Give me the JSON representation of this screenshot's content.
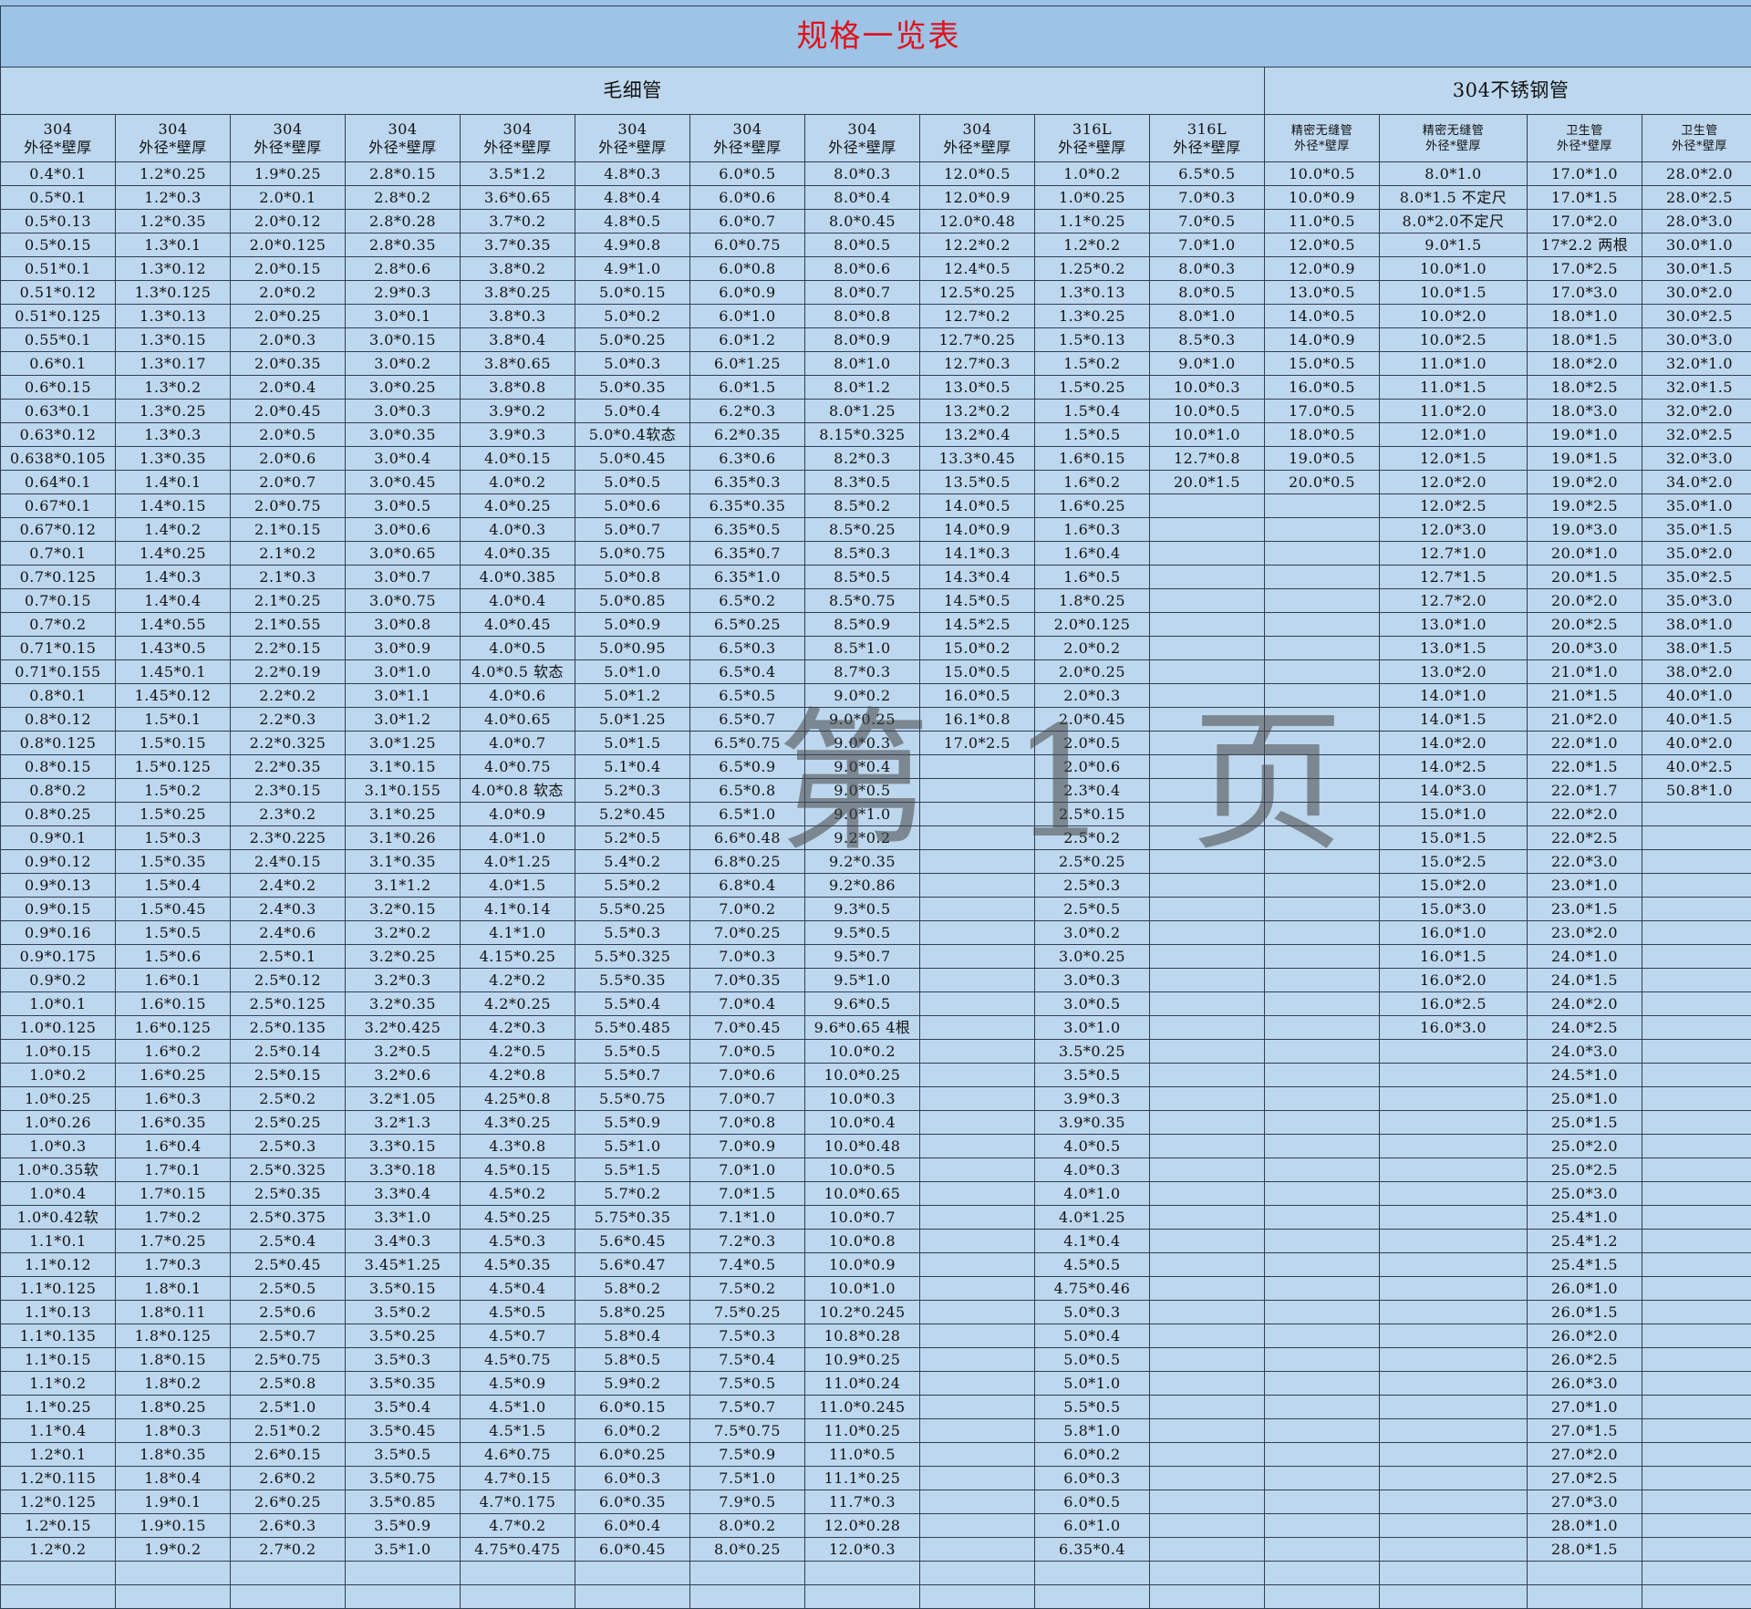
{
  "title": "规格一览表",
  "groups": [
    {
      "label": "毛细管",
      "span": 11
    },
    {
      "label": "304不锈钢管",
      "span": 4
    }
  ],
  "columns": [
    {
      "line1": "304",
      "line2": "外径*壁厚"
    },
    {
      "line1": "304",
      "line2": "外径*壁厚"
    },
    {
      "line1": "304",
      "line2": "外径*壁厚"
    },
    {
      "line1": "304",
      "line2": "外径*壁厚"
    },
    {
      "line1": "304",
      "line2": "外径*壁厚"
    },
    {
      "line1": "304",
      "line2": "外径*壁厚"
    },
    {
      "line1": "304",
      "line2": "外径*壁厚"
    },
    {
      "line1": "304",
      "line2": "外径*壁厚"
    },
    {
      "line1": "304",
      "line2": "外径*壁厚"
    },
    {
      "line1": "316L",
      "line2": "外径*壁厚"
    },
    {
      "line1": "316L",
      "line2": "外径*壁厚"
    },
    {
      "line1": "精密无缝管",
      "line2": "外径*壁厚"
    },
    {
      "line1": "精密无缝管",
      "line2": "外径*壁厚"
    },
    {
      "line1": "卫生管",
      "line2": "外径*壁厚"
    },
    {
      "line1": "卫生管",
      "line2": "外径*壁厚"
    }
  ],
  "column_data": [
    [
      "0.4*0.1",
      "0.5*0.1",
      "0.5*0.13",
      "0.5*0.15",
      "0.51*0.1",
      "0.51*0.12",
      "0.51*0.125",
      "0.55*0.1",
      "0.6*0.1",
      "0.6*0.15",
      "0.63*0.1",
      "0.63*0.12",
      "0.638*0.105",
      "0.64*0.1",
      "0.67*0.1",
      "0.67*0.12",
      "0.7*0.1",
      "0.7*0.125",
      "0.7*0.15",
      "0.7*0.2",
      "0.71*0.15",
      "0.71*0.155",
      "0.8*0.1",
      "0.8*0.12",
      "0.8*0.125",
      "0.8*0.15",
      "0.8*0.2",
      "0.8*0.25",
      "0.9*0.1",
      "0.9*0.12",
      "0.9*0.13",
      "0.9*0.15",
      "0.9*0.16",
      "0.9*0.175",
      "0.9*0.2",
      "1.0*0.1",
      "1.0*0.125",
      "1.0*0.15",
      "1.0*0.2",
      "1.0*0.25",
      "1.0*0.26",
      "1.0*0.3",
      "1.0*0.35软",
      "1.0*0.4",
      "1.0*0.42软",
      "1.1*0.1",
      "1.1*0.12",
      "1.1*0.125",
      "1.1*0.13",
      "1.1*0.135",
      "1.1*0.15",
      "1.1*0.2",
      "1.1*0.25",
      "1.1*0.4",
      "1.2*0.1",
      "1.2*0.115",
      "1.2*0.125",
      "1.2*0.15",
      "1.2*0.2"
    ],
    [
      "1.2*0.25",
      "1.2*0.3",
      "1.2*0.35",
      "1.3*0.1",
      "1.3*0.12",
      "1.3*0.125",
      "1.3*0.13",
      "1.3*0.15",
      "1.3*0.17",
      "1.3*0.2",
      "1.3*0.25",
      "1.3*0.3",
      "1.3*0.35",
      "1.4*0.1",
      "1.4*0.15",
      "1.4*0.2",
      "1.4*0.25",
      "1.4*0.3",
      "1.4*0.4",
      "1.4*0.55",
      "1.43*0.5",
      "1.45*0.1",
      "1.45*0.12",
      "1.5*0.1",
      "1.5*0.15",
      "1.5*0.125",
      "1.5*0.2",
      "1.5*0.25",
      "1.5*0.3",
      "1.5*0.35",
      "1.5*0.4",
      "1.5*0.45",
      "1.5*0.5",
      "1.5*0.6",
      "1.6*0.1",
      "1.6*0.15",
      "1.6*0.125",
      "1.6*0.2",
      "1.6*0.25",
      "1.6*0.3",
      "1.6*0.35",
      "1.6*0.4",
      "1.7*0.1",
      "1.7*0.15",
      "1.7*0.2",
      "1.7*0.25",
      "1.7*0.3",
      "1.8*0.1",
      "1.8*0.11",
      "1.8*0.125",
      "1.8*0.15",
      "1.8*0.2",
      "1.8*0.25",
      "1.8*0.3",
      "1.8*0.35",
      "1.8*0.4",
      "1.9*0.1",
      "1.9*0.15",
      "1.9*0.2"
    ],
    [
      "1.9*0.25",
      "2.0*0.1",
      "2.0*0.12",
      "2.0*0.125",
      "2.0*0.15",
      "2.0*0.2",
      "2.0*0.25",
      "2.0*0.3",
      "2.0*0.35",
      "2.0*0.4",
      "2.0*0.45",
      "2.0*0.5",
      "2.0*0.6",
      "2.0*0.7",
      "2.0*0.75",
      "2.1*0.15",
      "2.1*0.2",
      "2.1*0.3",
      "2.1*0.25",
      "2.1*0.55",
      "2.2*0.15",
      "2.2*0.19",
      "2.2*0.2",
      "2.2*0.3",
      "2.2*0.325",
      "2.2*0.35",
      "2.3*0.15",
      "2.3*0.2",
      "2.3*0.225",
      "2.4*0.15",
      "2.4*0.2",
      "2.4*0.3",
      "2.4*0.6",
      "2.5*0.1",
      "2.5*0.12",
      "2.5*0.125",
      "2.5*0.135",
      "2.5*0.14",
      "2.5*0.15",
      "2.5*0.2",
      "2.5*0.25",
      "2.5*0.3",
      "2.5*0.325",
      "2.5*0.35",
      "2.5*0.375",
      "2.5*0.4",
      "2.5*0.45",
      "2.5*0.5",
      "2.5*0.6",
      "2.5*0.7",
      "2.5*0.75",
      "2.5*0.8",
      "2.5*1.0",
      "2.51*0.2",
      "2.6*0.15",
      "2.6*0.2",
      "2.6*0.25",
      "2.6*0.3",
      "2.7*0.2"
    ],
    [
      "2.8*0.15",
      "2.8*0.2",
      "2.8*0.28",
      "2.8*0.35",
      "2.8*0.6",
      "2.9*0.3",
      "3.0*0.1",
      "3.0*0.15",
      "3.0*0.2",
      "3.0*0.25",
      "3.0*0.3",
      "3.0*0.35",
      "3.0*0.4",
      "3.0*0.45",
      "3.0*0.5",
      "3.0*0.6",
      "3.0*0.65",
      "3.0*0.7",
      "3.0*0.75",
      "3.0*0.8",
      "3.0*0.9",
      "3.0*1.0",
      "3.0*1.1",
      "3.0*1.2",
      "3.0*1.25",
      "3.1*0.15",
      "3.1*0.155",
      "3.1*0.25",
      "3.1*0.26",
      "3.1*0.35",
      "3.1*1.2",
      "3.2*0.15",
      "3.2*0.2",
      "3.2*0.25",
      "3.2*0.3",
      "3.2*0.35",
      "3.2*0.425",
      "3.2*0.5",
      "3.2*0.6",
      "3.2*1.05",
      "3.2*1.3",
      "3.3*0.15",
      "3.3*0.18",
      "3.3*0.4",
      "3.3*1.0",
      "3.4*0.3",
      "3.45*1.25",
      "3.5*0.15",
      "3.5*0.2",
      "3.5*0.25",
      "3.5*0.3",
      "3.5*0.35",
      "3.5*0.4",
      "3.5*0.45",
      "3.5*0.5",
      "3.5*0.75",
      "3.5*0.85",
      "3.5*0.9",
      "3.5*1.0"
    ],
    [
      "3.5*1.2",
      "3.6*0.65",
      "3.7*0.2",
      "3.7*0.35",
      "3.8*0.2",
      "3.8*0.25",
      "3.8*0.3",
      "3.8*0.4",
      "3.8*0.65",
      "3.8*0.8",
      "3.9*0.2",
      "3.9*0.3",
      "4.0*0.15",
      "4.0*0.2",
      "4.0*0.25",
      "4.0*0.3",
      "4.0*0.35",
      "4.0*0.385",
      "4.0*0.4",
      "4.0*0.45",
      "4.0*0.5",
      "4.0*0.5 软态",
      "4.0*0.6",
      "4.0*0.65",
      "4.0*0.7",
      "4.0*0.75",
      "4.0*0.8 软态",
      "4.0*0.9",
      "4.0*1.0",
      "4.0*1.25",
      "4.0*1.5",
      "4.1*0.14",
      "4.1*1.0",
      "4.15*0.25",
      "4.2*0.2",
      "4.2*0.25",
      "4.2*0.3",
      "4.2*0.5",
      "4.2*0.8",
      "4.25*0.8",
      "4.3*0.25",
      "4.3*0.8",
      "4.5*0.15",
      "4.5*0.2",
      "4.5*0.25",
      "4.5*0.3",
      "4.5*0.35",
      "4.5*0.4",
      "4.5*0.5",
      "4.5*0.7",
      "4.5*0.75",
      "4.5*0.9",
      "4.5*1.0",
      "4.5*1.5",
      "4.6*0.75",
      "4.7*0.15",
      "4.7*0.175",
      "4.7*0.2",
      "4.75*0.475"
    ],
    [
      "4.8*0.3",
      "4.8*0.4",
      "4.8*0.5",
      "4.9*0.8",
      "4.9*1.0",
      "5.0*0.15",
      "5.0*0.2",
      "5.0*0.25",
      "5.0*0.3",
      "5.0*0.35",
      "5.0*0.4",
      "5.0*0.4软态",
      "5.0*0.45",
      "5.0*0.5",
      "5.0*0.6",
      "5.0*0.7",
      "5.0*0.75",
      "5.0*0.8",
      "5.0*0.85",
      "5.0*0.9",
      "5.0*0.95",
      "5.0*1.0",
      "5.0*1.2",
      "5.0*1.25",
      "5.0*1.5",
      "5.1*0.4",
      "5.2*0.3",
      "5.2*0.45",
      "5.2*0.5",
      "5.4*0.2",
      "5.5*0.2",
      "5.5*0.25",
      "5.5*0.3",
      "5.5*0.325",
      "5.5*0.35",
      "5.5*0.4",
      "5.5*0.485",
      "5.5*0.5",
      "5.5*0.7",
      "5.5*0.75",
      "5.5*0.9",
      "5.5*1.0",
      "5.5*1.5",
      "5.7*0.2",
      "5.75*0.35",
      "5.6*0.45",
      "5.6*0.47",
      "5.8*0.2",
      "5.8*0.25",
      "5.8*0.4",
      "5.8*0.5",
      "5.9*0.2",
      "6.0*0.15",
      "6.0*0.2",
      "6.0*0.25",
      "6.0*0.3",
      "6.0*0.35",
      "6.0*0.4",
      "6.0*0.45"
    ],
    [
      "6.0*0.5",
      "6.0*0.6",
      "6.0*0.7",
      "6.0*0.75",
      "6.0*0.8",
      "6.0*0.9",
      "6.0*1.0",
      "6.0*1.2",
      "6.0*1.25",
      "6.0*1.5",
      "6.2*0.3",
      "6.2*0.35",
      "6.3*0.6",
      "6.35*0.3",
      "6.35*0.35",
      "6.35*0.5",
      "6.35*0.7",
      "6.35*1.0",
      "6.5*0.2",
      "6.5*0.25",
      "6.5*0.3",
      "6.5*0.4",
      "6.5*0.5",
      "6.5*0.7",
      "6.5*0.75",
      "6.5*0.9",
      "6.5*0.8",
      "6.5*1.0",
      "6.6*0.48",
      "6.8*0.25",
      "6.8*0.4",
      "7.0*0.2",
      "7.0*0.25",
      "7.0*0.3",
      "7.0*0.35",
      "7.0*0.4",
      "7.0*0.45",
      "7.0*0.5",
      "7.0*0.6",
      "7.0*0.7",
      "7.0*0.8",
      "7.0*0.9",
      "7.0*1.0",
      "7.0*1.5",
      "7.1*1.0",
      "7.2*0.3",
      "7.4*0.5",
      "7.5*0.2",
      "7.5*0.25",
      "7.5*0.3",
      "7.5*0.4",
      "7.5*0.5",
      "7.5*0.7",
      "7.5*0.75",
      "7.5*0.9",
      "7.5*1.0",
      "7.9*0.5",
      "8.0*0.2",
      "8.0*0.25"
    ],
    [
      "8.0*0.3",
      "8.0*0.4",
      "8.0*0.45",
      "8.0*0.5",
      "8.0*0.6",
      "8.0*0.7",
      "8.0*0.8",
      "8.0*0.9",
      "8.0*1.0",
      "8.0*1.2",
      "8.0*1.25",
      "8.15*0.325",
      "8.2*0.3",
      "8.3*0.5",
      "8.5*0.2",
      "8.5*0.25",
      "8.5*0.3",
      "8.5*0.5",
      "8.5*0.75",
      "8.5*0.9",
      "8.5*1.0",
      "8.7*0.3",
      "9.0*0.2",
      "9.0*0.25",
      "9.0*0.3",
      "9.0*0.4",
      "9.0*0.5",
      "9.0*1.0",
      "9.2*0.2",
      "9.2*0.35",
      "9.2*0.86",
      "9.3*0.5",
      "9.5*0.5",
      "9.5*0.7",
      "9.5*1.0",
      "9.6*0.5",
      "9.6*0.65 4根",
      "10.0*0.2",
      "10.0*0.25",
      "10.0*0.3",
      "10.0*0.4",
      "10.0*0.48",
      "10.0*0.5",
      "10.0*0.65",
      "10.0*0.7",
      "10.0*0.8",
      "10.0*0.9",
      "10.0*1.0",
      "10.2*0.245",
      "10.8*0.28",
      "10.9*0.25",
      "11.0*0.24",
      "11.0*0.245",
      "11.0*0.25",
      "11.0*0.5",
      "11.1*0.25",
      "11.7*0.3",
      "12.0*0.28",
      "12.0*0.3"
    ],
    [
      "12.0*0.5",
      "12.0*0.9",
      "12.0*0.48",
      "12.2*0.2",
      "12.4*0.5",
      "12.5*0.25",
      "12.7*0.2",
      "12.7*0.25",
      "12.7*0.3",
      "13.0*0.5",
      "13.2*0.2",
      "13.2*0.4",
      "13.3*0.45",
      "13.5*0.5",
      "14.0*0.5",
      "14.0*0.9",
      "14.1*0.3",
      "14.3*0.4",
      "14.5*0.5",
      "14.5*2.5",
      "15.0*0.2",
      "15.0*0.5",
      "16.0*0.5",
      "16.1*0.8",
      "17.0*2.5"
    ],
    [
      "1.0*0.2",
      "1.0*0.25",
      "1.1*0.25",
      "1.2*0.2",
      "1.25*0.2",
      "1.3*0.13",
      "1.3*0.25",
      "1.5*0.13",
      "1.5*0.2",
      "1.5*0.25",
      "1.5*0.4",
      "1.5*0.5",
      "1.6*0.15",
      "1.6*0.2",
      "1.6*0.25",
      "1.6*0.3",
      "1.6*0.4",
      "1.6*0.5",
      "1.8*0.25",
      "2.0*0.125",
      "2.0*0.2",
      "2.0*0.25",
      "2.0*0.3",
      "2.0*0.45",
      "2.0*0.5",
      "2.0*0.6",
      "2.3*0.4",
      "2.5*0.15",
      "2.5*0.2",
      "2.5*0.25",
      "2.5*0.3",
      "2.5*0.5",
      "3.0*0.2",
      "3.0*0.25",
      "3.0*0.3",
      "3.0*0.5",
      "3.0*1.0",
      "3.5*0.25",
      "3.5*0.5",
      "3.9*0.3",
      "3.9*0.35",
      "4.0*0.5",
      "4.0*0.3",
      "4.0*1.0",
      "4.0*1.25",
      "4.1*0.4",
      "4.5*0.5",
      "4.75*0.46",
      "5.0*0.3",
      "5.0*0.4",
      "5.0*0.5",
      "5.0*1.0",
      "5.5*0.5",
      "5.8*1.0",
      "6.0*0.2",
      "6.0*0.3",
      "6.0*0.5",
      "6.0*1.0",
      "6.35*0.4"
    ],
    [
      "6.5*0.5",
      "7.0*0.3",
      "7.0*0.5",
      "7.0*1.0",
      "8.0*0.3",
      "8.0*0.5",
      "8.0*1.0",
      "8.5*0.3",
      "9.0*1.0",
      "10.0*0.3",
      "10.0*0.5",
      "10.0*1.0",
      "12.7*0.8",
      "20.0*1.5"
    ],
    [
      "10.0*0.5",
      "10.0*0.9",
      "11.0*0.5",
      "12.0*0.5",
      "12.0*0.9",
      "13.0*0.5",
      "14.0*0.5",
      "14.0*0.9",
      "15.0*0.5",
      "16.0*0.5",
      "17.0*0.5",
      "18.0*0.5",
      "19.0*0.5",
      "20.0*0.5"
    ],
    [
      "8.0*1.0",
      "8.0*1.5 不定尺",
      "8.0*2.0不定尺",
      "9.0*1.5",
      "10.0*1.0",
      "10.0*1.5",
      "10.0*2.0",
      "10.0*2.5",
      "11.0*1.0",
      "11.0*1.5",
      "11.0*2.0",
      "12.0*1.0",
      "12.0*1.5",
      "12.0*2.0",
      "12.0*2.5",
      "12.0*3.0",
      "12.7*1.0",
      "12.7*1.5",
      "12.7*2.0",
      "13.0*1.0",
      "13.0*1.5",
      "13.0*2.0",
      "14.0*1.0",
      "14.0*1.5",
      "14.0*2.0",
      "14.0*2.5",
      "14.0*3.0",
      "15.0*1.0",
      "15.0*1.5",
      "15.0*2.5",
      "15.0*2.0",
      "15.0*3.0",
      "16.0*1.0",
      "16.0*1.5",
      "16.0*2.0",
      "16.0*2.5",
      "16.0*3.0"
    ],
    [
      "17.0*1.0",
      "17.0*1.5",
      "17.0*2.0",
      "17*2.2 两根",
      "17.0*2.5",
      "17.0*3.0",
      "18.0*1.0",
      "18.0*1.5",
      "18.0*2.0",
      "18.0*2.5",
      "18.0*3.0",
      "19.0*1.0",
      "19.0*1.5",
      "19.0*2.0",
      "19.0*2.5",
      "19.0*3.0",
      "20.0*1.0",
      "20.0*1.5",
      "20.0*2.0",
      "20.0*2.5",
      "20.0*3.0",
      "21.0*1.0",
      "21.0*1.5",
      "21.0*2.0",
      "22.0*1.0",
      "22.0*1.5",
      "22.0*1.7",
      "22.0*2.0",
      "22.0*2.5",
      "22.0*3.0",
      "23.0*1.0",
      "23.0*1.5",
      "23.0*2.0",
      "24.0*1.0",
      "24.0*1.5",
      "24.0*2.0",
      "24.0*2.5",
      "24.0*3.0",
      "24.5*1.0",
      "25.0*1.0",
      "25.0*1.5",
      "25.0*2.0",
      "25.0*2.5",
      "25.0*3.0",
      "25.4*1.0",
      "25.4*1.2",
      "25.4*1.5",
      "26.0*1.0",
      "26.0*1.5",
      "26.0*2.0",
      "26.0*2.5",
      "26.0*3.0",
      "27.0*1.0",
      "27.0*1.5",
      "27.0*2.0",
      "27.0*2.5",
      "27.0*3.0",
      "28.0*1.0",
      "28.0*1.5"
    ],
    [
      "28.0*2.0",
      "28.0*2.5",
      "28.0*3.0",
      "30.0*1.0",
      "30.0*1.5",
      "30.0*2.0",
      "30.0*2.5",
      "30.0*3.0",
      "32.0*1.0",
      "32.0*1.5",
      "32.0*2.0",
      "32.0*2.5",
      "32.0*3.0",
      "34.0*2.0",
      "35.0*1.0",
      "35.0*1.5",
      "35.0*2.0",
      "35.0*2.5",
      "35.0*3.0",
      "38.0*1.0",
      "38.0*1.5",
      "38.0*2.0",
      "40.0*1.0",
      "40.0*1.5",
      "40.0*2.0",
      "40.0*2.5",
      "50.8*1.0"
    ]
  ],
  "watermark": "第 1 页",
  "colors": {
    "title_text": "#e0121b",
    "sheet_background": "#bdd7ee",
    "banner_background": "#9dc3e6",
    "grid_lines": "#2f3e55"
  }
}
